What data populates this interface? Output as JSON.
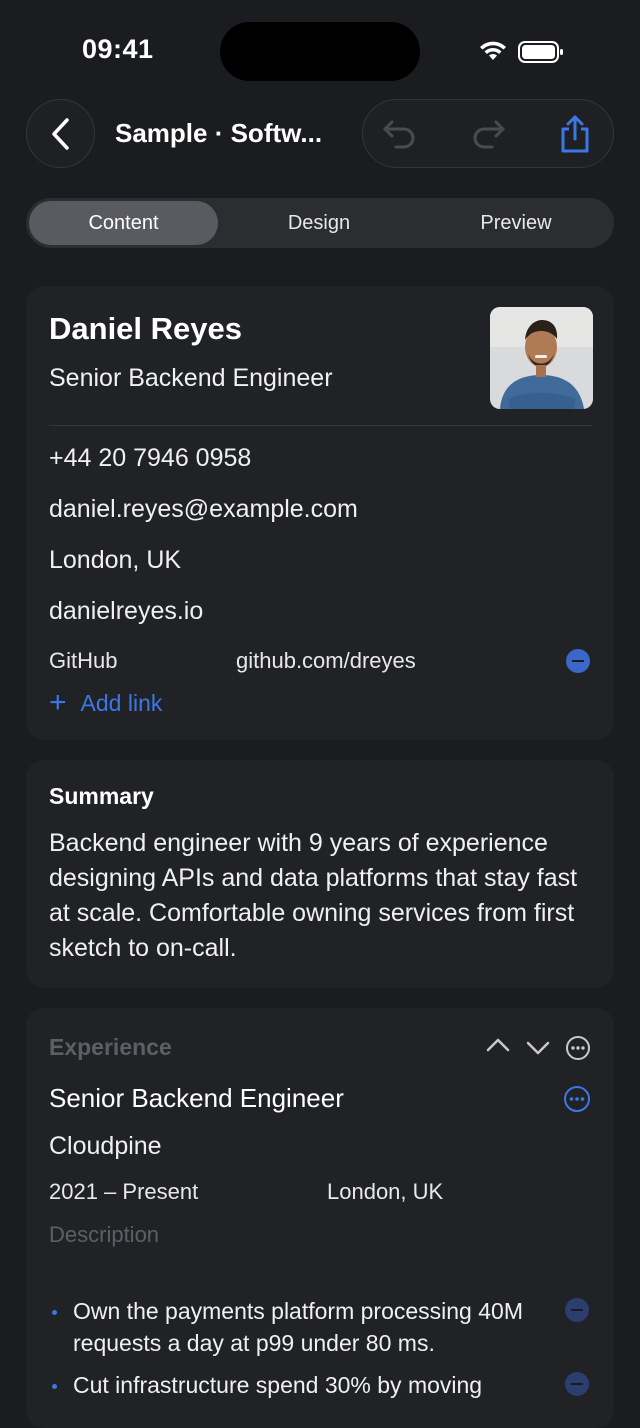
{
  "status": {
    "time": "09:41"
  },
  "nav": {
    "title": "Sample · Softw..."
  },
  "tabs": [
    {
      "label": "Content",
      "active": true
    },
    {
      "label": "Design",
      "active": false
    },
    {
      "label": "Preview",
      "active": false
    }
  ],
  "profile": {
    "name": "Daniel Reyes",
    "title": "Senior Backend Engineer",
    "phone": "+44 20 7946 0958",
    "email": "daniel.reyes@example.com",
    "location": "London, UK",
    "website": "danielreyes.io",
    "links": [
      {
        "label": "GitHub",
        "value": "github.com/dreyes"
      }
    ],
    "add_link_label": "Add link"
  },
  "summary": {
    "heading": "Summary",
    "text": "Backend engineer with 9 years of experience designing APIs and data platforms that stay fast at scale. Comfortable owning services from first sketch to on-call."
  },
  "experience": {
    "heading": "Experience",
    "entries": [
      {
        "role": "Senior Backend Engineer",
        "company": "Cloudpine",
        "dates": "2021 – Present",
        "location": "London, UK",
        "description_label": "Description",
        "bullets": [
          "Own the payments platform processing 40M requests a day at p99 under 80 ms.",
          "Cut infrastructure spend 30% by moving"
        ]
      }
    ]
  },
  "colors": {
    "accent": "#3b78e6",
    "background": "#1b1c1f",
    "card": "#212226"
  }
}
